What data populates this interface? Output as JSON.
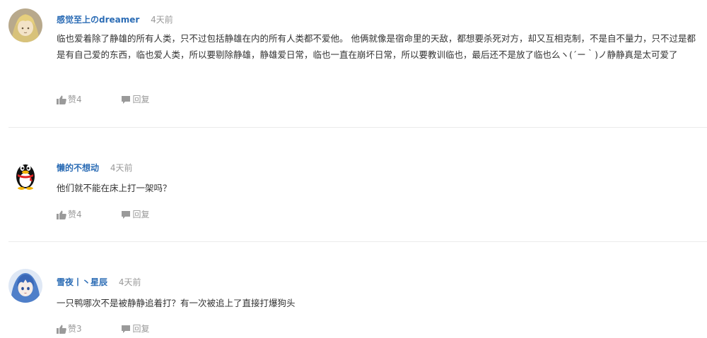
{
  "comments": [
    {
      "avatar": "anime-blonde-avatar",
      "username": "感觉至上のdreamer",
      "time": "4天前",
      "content": "临也爱着除了静雄的所有人类，只不过包括静雄在内的所有人类都不爱他。 他俩就像是宿命里的天敌，都想要杀死对方，却又互相克制，不是自不量力，只不过是都是有自己爱的东西，临也爱人类，所以要剔除静雄，静雄爱日常，临也一直在崩坏日常，所以要教训临也，最后还不是放了临也么ヽ(´ー｀)ノ静静真是太可爱了",
      "like_label": "赞4",
      "reply_label": "回复"
    },
    {
      "avatar": "qq-penguin-avatar",
      "username": "懒的不想动",
      "time": "4天前",
      "content": "他们就不能在床上打一架吗？",
      "like_label": "赞4",
      "reply_label": "回复"
    },
    {
      "avatar": "anime-blue-hair-avatar",
      "username": "雪夜丨丶星辰",
      "time": "4天前",
      "content": "一只鸭哪次不是被静静追着打？有一次被追上了直接打爆狗头",
      "like_label": "赞3",
      "reply_label": "回复"
    }
  ],
  "icons": {
    "like": "thumbs-up-icon",
    "reply": "speech-bubble-icon"
  },
  "colors": {
    "username": "#2b6cb5",
    "meta_gray": "#999999",
    "text": "#333333",
    "divider": "#ebebeb"
  }
}
